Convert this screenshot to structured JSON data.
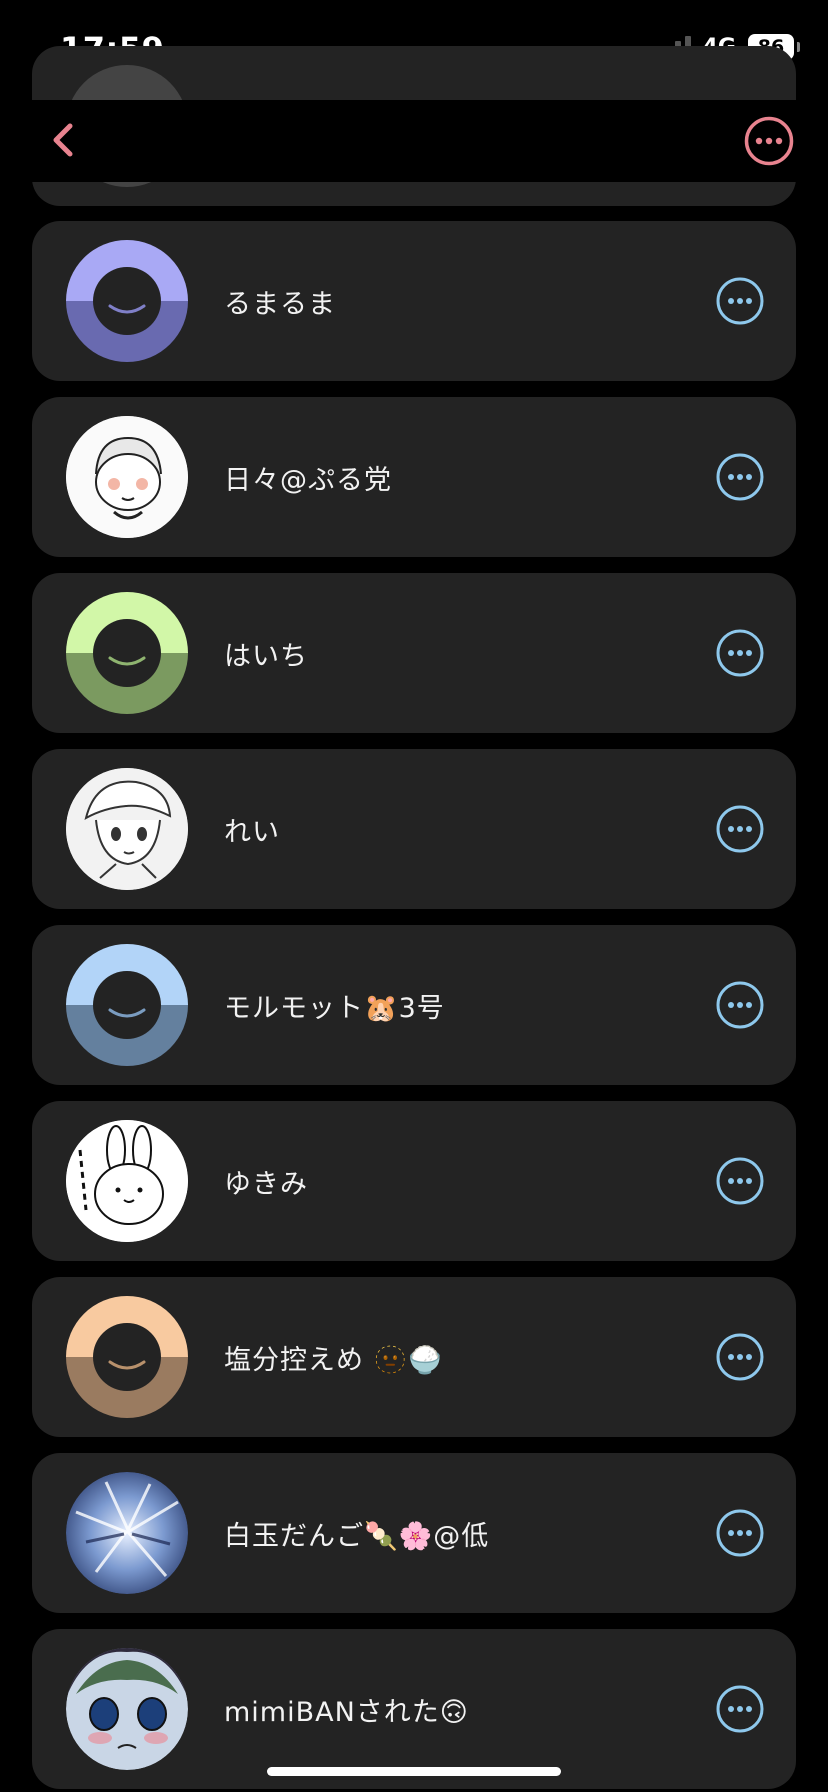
{
  "status": {
    "time": "17:59",
    "network": "4G",
    "battery": "86"
  },
  "colors": {
    "accent": "#e8838f",
    "row_menu": "#8ec8ec",
    "card_bg": "#232323"
  },
  "nav": {
    "back_icon": "chevron-left-icon",
    "menu_icon": "ellipsis-circle-icon"
  },
  "users": [
    {
      "name": "るまるま",
      "avatar": "default",
      "top": "#a9a9f5",
      "bottom": "#696ab0"
    },
    {
      "name": "日々@ぷる党",
      "avatar": "illustration"
    },
    {
      "name": "はいち",
      "avatar": "default",
      "top": "#d2f7a8",
      "bottom": "#7b9a60"
    },
    {
      "name": "れい",
      "avatar": "illustration"
    },
    {
      "name": "モルモット🐹3号",
      "avatar": "default",
      "top": "#b2d4f8",
      "bottom": "#64809e"
    },
    {
      "name": "ゆきみ",
      "avatar": "illustration"
    },
    {
      "name": "塩分控えめ 🫥🍚",
      "avatar": "default",
      "top": "#f8caa0",
      "bottom": "#9a7b60"
    },
    {
      "name": "白玉だんご🍡🌸@低",
      "avatar": "photo"
    },
    {
      "name": "mimiBANされた🙃",
      "avatar": "illustration"
    }
  ]
}
